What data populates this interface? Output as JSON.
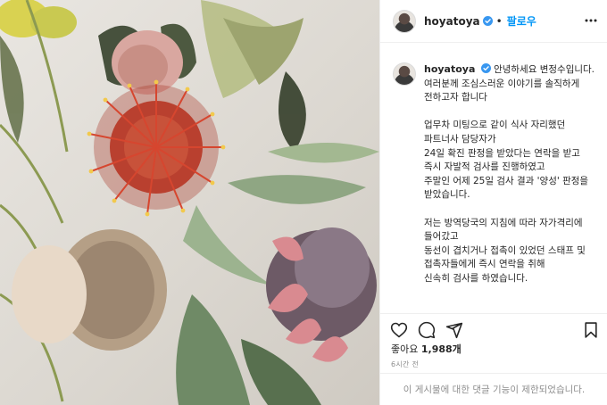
{
  "post": {
    "username": "hoyatoya",
    "follow_label": "팔로우",
    "caption_lines": [
      "안녕하세요 변정수입니다.",
      "여러분께 조심스러운 이야기를 솔직하게 전하고자 합니다",
      "",
      "업무차 미팅으로 같이 식사 자리했던 파트너사 담당자가",
      "24일 확진 판정을 받았다는 연락을 받고",
      "즉시 자발적 검사를 진행하였고",
      "주말인 어제 25일 검사 결과 '양성' 판정을 받았습니다.",
      "",
      "저는 방역당국의 지침에 따라 자가격리에 들어갔고",
      "동선이 겹치거나 접촉이 있었던 스태프 및",
      "접촉자들에게 즉시 연락을 취해",
      "신속히 검사를 하였습니다."
    ],
    "likes_prefix": "좋아요",
    "likes_count": "1,988개",
    "time_ago": "6시간 전",
    "comments_disabled": "이 게시물에 대한 댓글 기능이 제한되었습니다."
  },
  "icons": {
    "verified": "verified-badge-icon",
    "more": "more-options-icon",
    "like": "heart-icon",
    "comment": "comment-icon",
    "share": "share-icon",
    "save": "bookmark-icon"
  },
  "colors": {
    "accent": "#0095f6",
    "text": "#262626",
    "muted": "#8e8e8e",
    "border": "#efefef"
  }
}
